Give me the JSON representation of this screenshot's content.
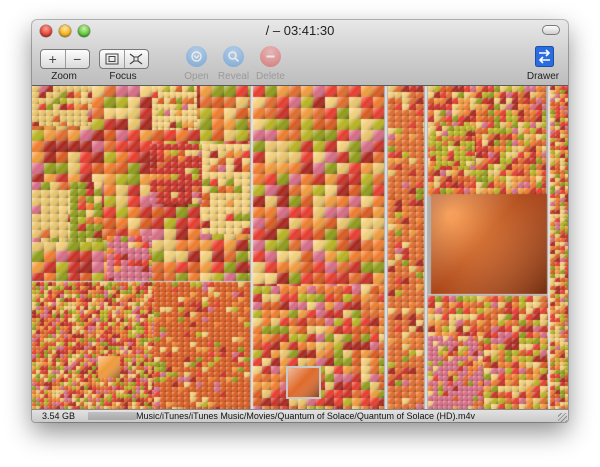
{
  "window": {
    "title": "/ – 03:41:30"
  },
  "toolbar": {
    "zoom": {
      "label": "Zoom",
      "in_symbol": "+",
      "out_symbol": "−"
    },
    "focus": {
      "label": "Focus",
      "out_symbol": "⊡",
      "in_symbol": "⤧"
    },
    "open": {
      "label": "Open",
      "enabled": false,
      "color": "#3d8fe0"
    },
    "reveal": {
      "label": "Reveal",
      "enabled": false,
      "color": "#3d8fe0"
    },
    "delete": {
      "label": "Delete",
      "enabled": false,
      "color": "#e03a3a"
    },
    "drawer": {
      "label": "Drawer",
      "color": "#2b6de0"
    }
  },
  "status": {
    "size": "3.54 GB",
    "path": "Music/iTunes/iTunes Music/Movies/Quantum of Solace/Quantum of Solace (HD).m4v"
  },
  "treemap": {
    "palette": [
      "#e83a2a",
      "#d9591c",
      "#c92e22",
      "#e06a2a",
      "#f09a3a",
      "#e9c46a",
      "#f3cf7a",
      "#b8b21f",
      "#8f9a16",
      "#d66a82",
      "#a8241a",
      "#f07a2a"
    ],
    "selected_item": "Quantum of Solace (HD).m4v"
  }
}
